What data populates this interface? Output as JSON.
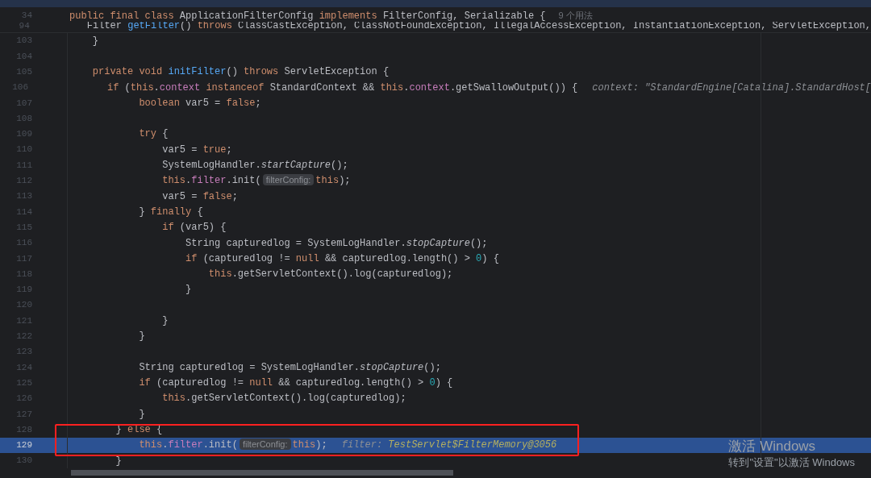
{
  "sticky_header": [
    {
      "number": "34",
      "tokens": [
        {
          "kind": "k",
          "text": "public final class "
        },
        {
          "kind": "p",
          "text": "ApplicationFilterConfig "
        },
        {
          "kind": "k",
          "text": "implements "
        },
        {
          "kind": "p",
          "text": "FilterConfig, Serializable {"
        }
      ],
      "usages": "9 个用法"
    },
    {
      "number": "94",
      "tokens": [
        {
          "kind": "p",
          "text": "    Filter "
        },
        {
          "kind": "m",
          "text": "getFilter"
        },
        {
          "kind": "p",
          "text": "() "
        },
        {
          "kind": "k",
          "text": "throws "
        },
        {
          "kind": "p",
          "text": "ClassCastException, ClassNotFoundException, IllegalAccessException, InstantiationException, ServletException,"
        }
      ]
    }
  ],
  "lines": [
    {
      "number": "103",
      "tokens": [
        {
          "kind": "p",
          "text": "    }"
        }
      ],
      "highlighted": false,
      "boxed": false
    },
    {
      "number": "104",
      "highlighted": false,
      "boxed": false
    },
    {
      "number": "105",
      "tokens": [
        {
          "kind": "k",
          "text": "    private void "
        },
        {
          "kind": "m",
          "text": "initFilter"
        },
        {
          "kind": "p",
          "text": "() "
        },
        {
          "kind": "k",
          "text": "throws "
        },
        {
          "kind": "p",
          "text": "ServletException {"
        }
      ],
      "highlighted": false,
      "boxed": false
    },
    {
      "number": "106",
      "tokens": [
        {
          "kind": "k",
          "text": "        if "
        },
        {
          "kind": "p",
          "text": "("
        },
        {
          "kind": "k",
          "text": "this"
        },
        {
          "kind": "p",
          "text": "."
        },
        {
          "kind": "f",
          "text": "context "
        },
        {
          "kind": "k",
          "text": "instanceof "
        },
        {
          "kind": "p",
          "text": "StandardContext && "
        },
        {
          "kind": "k",
          "text": "this"
        },
        {
          "kind": "p",
          "text": "."
        },
        {
          "kind": "f",
          "text": "context"
        },
        {
          "kind": "p",
          "text": ".getSwallowOutput()) {"
        }
      ],
      "inline_value": {
        "name": "context:",
        "value": "\"StandardEngine[Catalina].StandardHost["
      },
      "highlighted": false,
      "boxed": false
    },
    {
      "number": "107",
      "tokens": [
        {
          "kind": "k",
          "text": "            boolean "
        },
        {
          "kind": "p",
          "text": "var5 = "
        },
        {
          "kind": "k",
          "text": "false"
        },
        {
          "kind": "p",
          "text": ";"
        }
      ],
      "highlighted": false,
      "boxed": false
    },
    {
      "number": "108",
      "highlighted": false,
      "boxed": false
    },
    {
      "number": "109",
      "tokens": [
        {
          "kind": "k",
          "text": "            try "
        },
        {
          "kind": "p",
          "text": "{"
        }
      ],
      "highlighted": false,
      "boxed": false
    },
    {
      "number": "110",
      "tokens": [
        {
          "kind": "p",
          "text": "                var5 = "
        },
        {
          "kind": "k",
          "text": "true"
        },
        {
          "kind": "p",
          "text": ";"
        }
      ],
      "highlighted": false,
      "boxed": false
    },
    {
      "number": "111",
      "tokens": [
        {
          "kind": "p",
          "text": "                SystemLogHandler."
        },
        {
          "kind": "s",
          "text": "startCapture"
        },
        {
          "kind": "p",
          "text": "();"
        }
      ],
      "highlighted": false,
      "boxed": false
    },
    {
      "number": "112",
      "tokens": [
        {
          "kind": "k",
          "text": "                this"
        },
        {
          "kind": "p",
          "text": "."
        },
        {
          "kind": "f",
          "text": "filter"
        },
        {
          "kind": "p",
          "text": ".init("
        },
        {
          "kind": "h",
          "text": "filterConfig:"
        },
        {
          "kind": "k",
          "text": "this"
        },
        {
          "kind": "p",
          "text": ");"
        }
      ],
      "highlighted": false,
      "boxed": false
    },
    {
      "number": "113",
      "tokens": [
        {
          "kind": "p",
          "text": "                var5 = "
        },
        {
          "kind": "k",
          "text": "false"
        },
        {
          "kind": "p",
          "text": ";"
        }
      ],
      "highlighted": false,
      "boxed": false
    },
    {
      "number": "114",
      "tokens": [
        {
          "kind": "p",
          "text": "            } "
        },
        {
          "kind": "k",
          "text": "finally "
        },
        {
          "kind": "p",
          "text": "{"
        }
      ],
      "highlighted": false,
      "boxed": false
    },
    {
      "number": "115",
      "tokens": [
        {
          "kind": "k",
          "text": "                if "
        },
        {
          "kind": "p",
          "text": "(var5) {"
        }
      ],
      "highlighted": false,
      "boxed": false
    },
    {
      "number": "116",
      "tokens": [
        {
          "kind": "p",
          "text": "                    String capturedlog = SystemLogHandler."
        },
        {
          "kind": "s",
          "text": "stopCapture"
        },
        {
          "kind": "p",
          "text": "();"
        }
      ],
      "highlighted": false,
      "boxed": false
    },
    {
      "number": "117",
      "tokens": [
        {
          "kind": "k",
          "text": "                    if "
        },
        {
          "kind": "p",
          "text": "(capturedlog != "
        },
        {
          "kind": "k",
          "text": "null "
        },
        {
          "kind": "p",
          "text": "&& capturedlog.length() > "
        },
        {
          "kind": "n",
          "text": "0"
        },
        {
          "kind": "p",
          "text": ") {"
        }
      ],
      "highlighted": false,
      "boxed": false
    },
    {
      "number": "118",
      "tokens": [
        {
          "kind": "k",
          "text": "                        this"
        },
        {
          "kind": "p",
          "text": ".getServletContext().log(capturedlog);"
        }
      ],
      "highlighted": false,
      "boxed": false
    },
    {
      "number": "119",
      "tokens": [
        {
          "kind": "p",
          "text": "                    }"
        }
      ],
      "highlighted": false,
      "boxed": false
    },
    {
      "number": "120",
      "highlighted": false,
      "boxed": false
    },
    {
      "number": "121",
      "tokens": [
        {
          "kind": "p",
          "text": "                }"
        }
      ],
      "highlighted": false,
      "boxed": false
    },
    {
      "number": "122",
      "tokens": [
        {
          "kind": "p",
          "text": "            }"
        }
      ],
      "highlighted": false,
      "boxed": false
    },
    {
      "number": "123",
      "highlighted": false,
      "boxed": false
    },
    {
      "number": "124",
      "tokens": [
        {
          "kind": "p",
          "text": "            String capturedlog = SystemLogHandler."
        },
        {
          "kind": "s",
          "text": "stopCapture"
        },
        {
          "kind": "p",
          "text": "();"
        }
      ],
      "highlighted": false,
      "boxed": false
    },
    {
      "number": "125",
      "tokens": [
        {
          "kind": "k",
          "text": "            if "
        },
        {
          "kind": "p",
          "text": "(capturedlog != "
        },
        {
          "kind": "k",
          "text": "null "
        },
        {
          "kind": "p",
          "text": "&& capturedlog.length() > "
        },
        {
          "kind": "n",
          "text": "0"
        },
        {
          "kind": "p",
          "text": ") {"
        }
      ],
      "highlighted": false,
      "boxed": false
    },
    {
      "number": "126",
      "tokens": [
        {
          "kind": "k",
          "text": "                this"
        },
        {
          "kind": "p",
          "text": ".getServletContext().log(capturedlog);"
        }
      ],
      "highlighted": false,
      "boxed": false
    },
    {
      "number": "127",
      "tokens": [
        {
          "kind": "p",
          "text": "            }"
        }
      ],
      "highlighted": false,
      "boxed": false
    },
    {
      "number": "128",
      "tokens": [
        {
          "kind": "p",
          "text": "        } "
        },
        {
          "kind": "k",
          "text": "else "
        },
        {
          "kind": "p",
          "text": "{"
        }
      ],
      "highlighted": false,
      "boxed": true
    },
    {
      "number": "129",
      "tokens": [
        {
          "kind": "k",
          "text": "            this"
        },
        {
          "kind": "p",
          "text": "."
        },
        {
          "kind": "f",
          "text": "filter"
        },
        {
          "kind": "p",
          "text": ".init("
        },
        {
          "kind": "h",
          "text": "filterConfig:"
        },
        {
          "kind": "k",
          "text": "this"
        },
        {
          "kind": "p",
          "text": ");"
        }
      ],
      "inline_value": {
        "name": "filter:",
        "value": "TestServlet$FilterMemory@3056",
        "emphasis": true
      },
      "highlighted": true,
      "boxed": true
    },
    {
      "number": "130",
      "tokens": [
        {
          "kind": "p",
          "text": "        }"
        }
      ],
      "highlighted": false,
      "boxed": false
    }
  ],
  "activation_notice": {
    "title": "激活 Windows",
    "text": "转到\"设置\"以激活 Windows"
  }
}
